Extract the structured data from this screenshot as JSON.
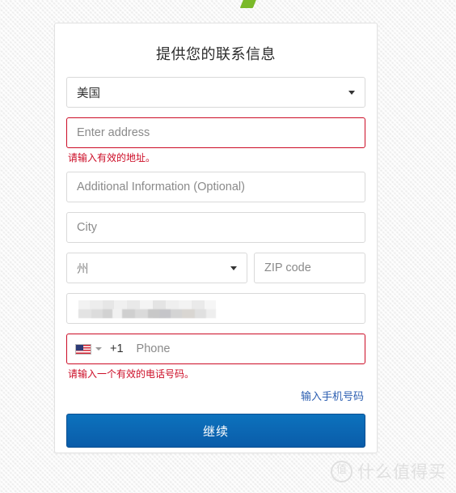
{
  "page": {
    "background_color": "#f4f4f4",
    "logo_fragment_color": "#7ab929"
  },
  "card": {
    "title": "提供您的联系信息",
    "accent_color": "#0d72bd",
    "error_color": "#cc0c26",
    "link_color": "#2a5db0"
  },
  "form": {
    "country": {
      "label_name": "country-select",
      "value": "美国",
      "icon": "chevron-down-icon"
    },
    "address": {
      "placeholder": "Enter address",
      "value": "",
      "error": "请输入有效的地址。",
      "has_error": true
    },
    "additional": {
      "placeholder": "Additional Information (Optional)",
      "value": ""
    },
    "city": {
      "placeholder": "City",
      "value": ""
    },
    "state": {
      "value": "州",
      "icon": "chevron-down-icon"
    },
    "zip": {
      "placeholder": "ZIP code",
      "value": ""
    },
    "redacted_field": {
      "value": "",
      "note": "blurred"
    },
    "phone": {
      "flag_icon": "us-flag-icon",
      "flag_caret_icon": "chevron-down-icon",
      "dial_code": "+1",
      "placeholder": "Phone",
      "value": "",
      "error": "请输入一个有效的电话号码。",
      "has_error": true
    },
    "helper_link": "输入手机号码",
    "submit_label": "继续"
  },
  "watermark": {
    "badge": "值",
    "text": "什么值得买"
  }
}
